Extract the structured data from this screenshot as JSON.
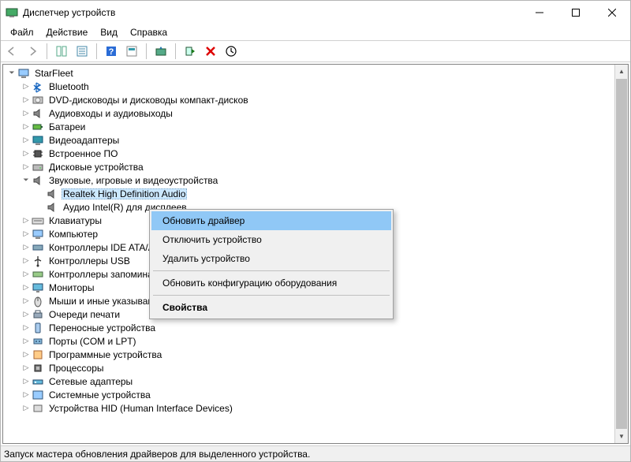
{
  "window": {
    "title": "Диспетчер устройств"
  },
  "menu": {
    "file": "Файл",
    "action": "Действие",
    "view": "Вид",
    "help": "Справка"
  },
  "tree": {
    "root": "StarFleet",
    "nodes": [
      "Bluetooth",
      "DVD-дисководы и дисководы компакт-дисков",
      "Аудиовходы и аудиовыходы",
      "Батареи",
      "Видеоадаптеры",
      "Встроенное ПО",
      "Дисковые устройства",
      "Звуковые, игровые и видеоустройства",
      "Клавиатуры",
      "Компьютер",
      "Контроллеры IDE ATA/ATAPI",
      "Контроллеры USB",
      "Контроллеры запоминающих устройств",
      "Мониторы",
      "Мыши и иные указывающие устройства",
      "Очереди печати",
      "Переносные устройства",
      "Порты (COM и LPT)",
      "Программные устройства",
      "Процессоры",
      "Сетевые адаптеры",
      "Системные устройства",
      "Устройства HID (Human Interface Devices)"
    ],
    "audio_children": {
      "realtek": "Realtek High Definition Audio",
      "intel": "Аудио Intel(R) для дисплеев"
    }
  },
  "context_menu": {
    "update": "Обновить драйвер",
    "disable": "Отключить устройство",
    "uninstall": "Удалить устройство",
    "scan": "Обновить конфигурацию оборудования",
    "properties": "Свойства"
  },
  "status": "Запуск мастера обновления драйверов для выделенного устройства."
}
